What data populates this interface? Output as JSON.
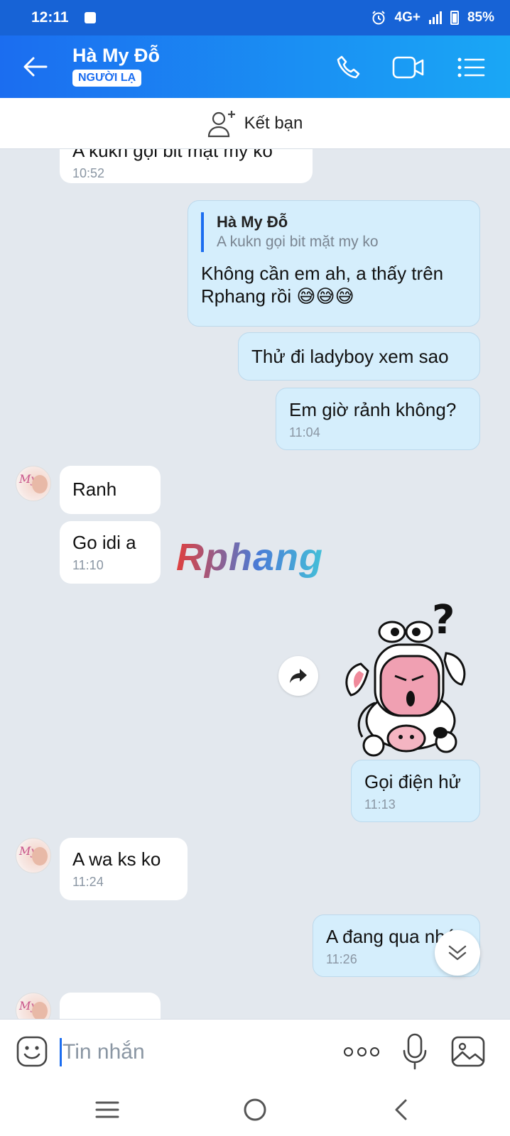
{
  "status_bar": {
    "time": "12:11",
    "network": "4G+",
    "battery": "85%"
  },
  "header": {
    "title": "Hà My Đỗ",
    "tag": "NGƯỜI LẠ"
  },
  "add_friend": {
    "label": "Kết bạn"
  },
  "watermark": "Rphang",
  "messages": [
    {
      "id": "m1",
      "direction": "in",
      "text": "A kukn gọi bit mặt my ko",
      "time": "10:52"
    },
    {
      "id": "m2",
      "direction": "out",
      "reply_to": {
        "name": "Hà My Đỗ",
        "text": "A kukn gọi bit mặt my ko"
      },
      "text_line1": "Không cần em ah, a thấy trên",
      "text_line2": "Rphang rồi 😅😅😅"
    },
    {
      "id": "m3",
      "direction": "out",
      "text": "Thử đi ladyboy xem sao"
    },
    {
      "id": "m4",
      "direction": "out",
      "text": "Em giờ rảnh không?",
      "time": "11:04"
    },
    {
      "id": "m5",
      "direction": "in",
      "text": "Ranh"
    },
    {
      "id": "m6",
      "direction": "in",
      "text": "Go idi a",
      "time": "11:10"
    },
    {
      "id": "m7",
      "direction": "out",
      "sticker": "confused-cow-sticker"
    },
    {
      "id": "m8",
      "direction": "out",
      "text": "Gọi điện hử",
      "time": "11:13"
    },
    {
      "id": "m9",
      "direction": "in",
      "text": "A wa ks ko",
      "time": "11:24"
    },
    {
      "id": "m10",
      "direction": "out",
      "text": "A đang qua nhé",
      "time": "11:26"
    }
  ],
  "input_bar": {
    "placeholder": "Tin nhắn"
  },
  "icons": {
    "back": "arrow-left-icon",
    "call": "phone-icon",
    "video": "video-camera-icon",
    "menu": "list-menu-icon",
    "add_friend": "add-user-icon",
    "forward": "forward-share-icon",
    "scroll_down": "double-chevron-down-icon",
    "emoji": "emoji-icon",
    "more": "more-dots-icon",
    "mic": "microphone-icon",
    "gallery": "image-gallery-icon"
  },
  "colors": {
    "accent": "#1b6df0",
    "header_end": "#1aa7f5",
    "outgoing_bubble": "#d5eefc",
    "incoming_bubble": "#ffffff",
    "chat_bg": "#e3e8ee"
  }
}
